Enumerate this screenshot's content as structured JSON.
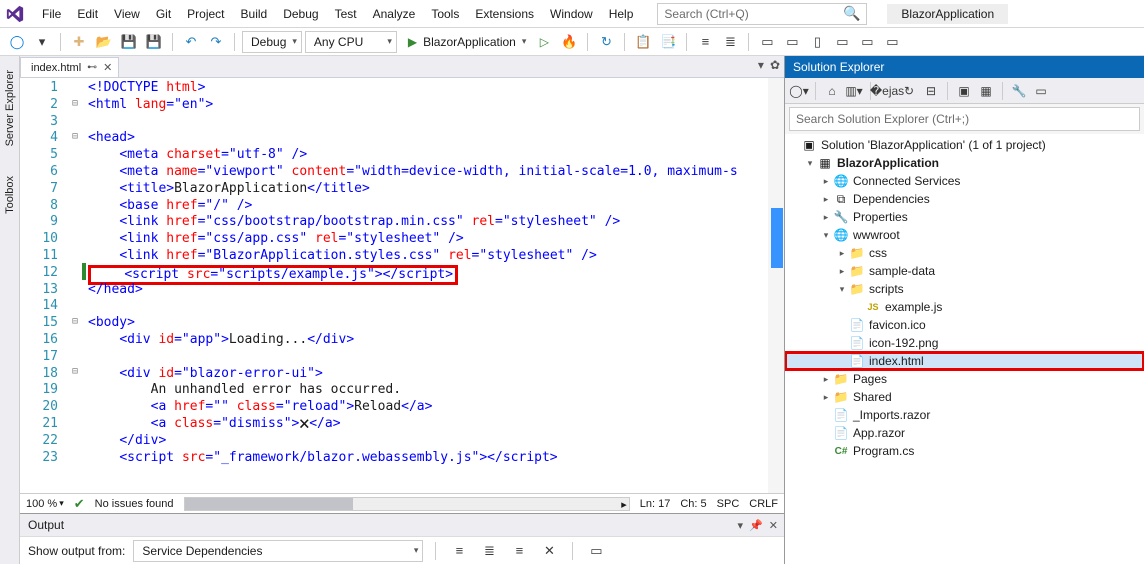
{
  "menu": {
    "items": [
      "File",
      "Edit",
      "View",
      "Git",
      "Project",
      "Build",
      "Debug",
      "Test",
      "Analyze",
      "Tools",
      "Extensions",
      "Window",
      "Help"
    ]
  },
  "header": {
    "searchPlaceholder": "Search (Ctrl+Q)",
    "appName": "BlazorApplication"
  },
  "toolbar": {
    "config": "Debug",
    "platform": "Any CPU",
    "runTarget": "BlazorApplication"
  },
  "doc": {
    "tab": "index.html"
  },
  "editor": {
    "lines": [
      {
        "n": 1,
        "fold": "",
        "chg": "",
        "html": "<span class='c-blue'>&lt;!DOCTYPE</span> <span class='c-red'>html</span><span class='c-blue'>&gt;</span>"
      },
      {
        "n": 2,
        "fold": "⊟",
        "chg": "",
        "html": "<span class='c-blue'>&lt;html</span> <span class='c-red'>lang</span><span class='c-blue'>=</span><span class='c-blue'>\"en\"</span><span class='c-blue'>&gt;</span>"
      },
      {
        "n": 3,
        "fold": "",
        "chg": "",
        "html": ""
      },
      {
        "n": 4,
        "fold": "⊟",
        "chg": "",
        "html": "<span class='c-blue'>&lt;head&gt;</span>"
      },
      {
        "n": 5,
        "fold": "",
        "chg": "",
        "html": "    <span class='c-blue'>&lt;meta</span> <span class='c-red'>charset</span><span class='c-blue'>=\"utf-8\"</span> <span class='c-blue'>/&gt;</span>"
      },
      {
        "n": 6,
        "fold": "",
        "chg": "",
        "html": "    <span class='c-blue'>&lt;meta</span> <span class='c-red'>name</span><span class='c-blue'>=\"viewport\"</span> <span class='c-red'>content</span><span class='c-blue'>=\"width=device-width, initial-scale=1.0, maximum-s</span>"
      },
      {
        "n": 7,
        "fold": "",
        "chg": "",
        "html": "    <span class='c-blue'>&lt;title&gt;</span>BlazorApplication<span class='c-blue'>&lt;/title&gt;</span>"
      },
      {
        "n": 8,
        "fold": "",
        "chg": "",
        "html": "    <span class='c-blue'>&lt;base</span> <span class='c-red'>href</span><span class='c-blue'>=\"/\"</span> <span class='c-blue'>/&gt;</span>"
      },
      {
        "n": 9,
        "fold": "",
        "chg": "",
        "html": "    <span class='c-blue'>&lt;link</span> <span class='c-red'>href</span><span class='c-blue'>=\"css/bootstrap/bootstrap.min.css\"</span> <span class='c-red'>rel</span><span class='c-blue'>=\"stylesheet\"</span> <span class='c-blue'>/&gt;</span>"
      },
      {
        "n": 10,
        "fold": "",
        "chg": "",
        "html": "    <span class='c-blue'>&lt;link</span> <span class='c-red'>href</span><span class='c-blue'>=\"css/app.css\"</span> <span class='c-red'>rel</span><span class='c-blue'>=\"stylesheet\"</span> <span class='c-blue'>/&gt;</span>"
      },
      {
        "n": 11,
        "fold": "",
        "chg": "",
        "html": "    <span class='c-blue'>&lt;link</span> <span class='c-red'>href</span><span class='c-blue'>=\"BlazorApplication.styles.css\"</span> <span class='c-red'>rel</span><span class='c-blue'>=\"stylesheet\"</span> <span class='c-blue'>/&gt;</span>"
      },
      {
        "n": 12,
        "fold": "",
        "chg": "g",
        "boxed": true,
        "html": "    <span class='c-blue'>&lt;script</span> <span class='c-red'>src</span><span class='c-blue'>=\"scripts/example.js\"&gt;&lt;/script&gt;</span>"
      },
      {
        "n": 13,
        "fold": "",
        "chg": "",
        "html": "<span class='c-blue'>&lt;/head&gt;</span>"
      },
      {
        "n": 14,
        "fold": "",
        "chg": "",
        "html": ""
      },
      {
        "n": 15,
        "fold": "⊟",
        "chg": "",
        "html": "<span class='c-blue'>&lt;body&gt;</span>"
      },
      {
        "n": 16,
        "fold": "",
        "chg": "",
        "html": "    <span class='c-blue'>&lt;div</span> <span class='c-red'>id</span><span class='c-blue'>=\"app\"&gt;</span>Loading...<span class='c-blue'>&lt;/div&gt;</span>"
      },
      {
        "n": 17,
        "fold": "",
        "chg": "",
        "html": ""
      },
      {
        "n": 18,
        "fold": "⊟",
        "chg": "",
        "html": "    <span class='c-blue'>&lt;div</span> <span class='c-red'>id</span><span class='c-blue'>=\"blazor-error-ui\"&gt;</span>"
      },
      {
        "n": 19,
        "fold": "",
        "chg": "",
        "html": "        An unhandled error has occurred."
      },
      {
        "n": 20,
        "fold": "",
        "chg": "",
        "html": "        <span class='c-blue'>&lt;a</span> <span class='c-red'>href</span><span class='c-blue'>=\"\"</span> <span class='c-red'>class</span><span class='c-blue'>=\"reload\"&gt;</span>Reload<span class='c-blue'>&lt;/a&gt;</span>"
      },
      {
        "n": 21,
        "fold": "",
        "chg": "",
        "html": "        <span class='c-blue'>&lt;a</span> <span class='c-red'>class</span><span class='c-blue'>=\"dismiss\"&gt;</span>🗙<span class='c-blue'>&lt;/a&gt;</span>"
      },
      {
        "n": 22,
        "fold": "",
        "chg": "",
        "html": "    <span class='c-blue'>&lt;/div&gt;</span>"
      },
      {
        "n": 23,
        "fold": "",
        "chg": "",
        "html": "    <span class='c-blue'>&lt;script</span> <span class='c-red'>src</span><span class='c-blue'>=\"_framework/blazor.webassembly.js\"&gt;&lt;/script&gt;</span>"
      }
    ]
  },
  "edstatus": {
    "zoom": "100 %",
    "issues": "No issues found",
    "ln": "Ln: 17",
    "ch": "Ch: 5",
    "spc": "SPC",
    "crlf": "CRLF"
  },
  "output": {
    "title": "Output",
    "label": "Show output from:",
    "source": "Service Dependencies"
  },
  "solexp": {
    "title": "Solution Explorer",
    "searchPlaceholder": "Search Solution Explorer (Ctrl+;)",
    "nodes": [
      {
        "d": 0,
        "tw": "",
        "ico": "sln",
        "label": "Solution 'BlazorApplication' (1 of 1 project)"
      },
      {
        "d": 1,
        "tw": "▾",
        "ico": "proj",
        "label": "BlazorApplication",
        "bold": true
      },
      {
        "d": 2,
        "tw": "▸",
        "ico": "globe",
        "label": "Connected Services"
      },
      {
        "d": 2,
        "tw": "▸",
        "ico": "ref",
        "label": "Dependencies"
      },
      {
        "d": 2,
        "tw": "▸",
        "ico": "wrench",
        "label": "Properties"
      },
      {
        "d": 2,
        "tw": "▾",
        "ico": "globe",
        "label": "wwwroot"
      },
      {
        "d": 3,
        "tw": "▸",
        "ico": "folder",
        "label": "css"
      },
      {
        "d": 3,
        "tw": "▸",
        "ico": "folder",
        "label": "sample-data"
      },
      {
        "d": 3,
        "tw": "▾",
        "ico": "folder",
        "label": "scripts"
      },
      {
        "d": 4,
        "tw": "",
        "ico": "js",
        "label": "example.js"
      },
      {
        "d": 3,
        "tw": "",
        "ico": "file",
        "label": "favicon.ico"
      },
      {
        "d": 3,
        "tw": "",
        "ico": "file",
        "label": "icon-192.png"
      },
      {
        "d": 3,
        "tw": "",
        "ico": "file",
        "label": "index.html",
        "sel": true,
        "red": true
      },
      {
        "d": 2,
        "tw": "▸",
        "ico": "folder",
        "label": "Pages"
      },
      {
        "d": 2,
        "tw": "▸",
        "ico": "folder",
        "label": "Shared"
      },
      {
        "d": 2,
        "tw": "",
        "ico": "file",
        "label": "_Imports.razor"
      },
      {
        "d": 2,
        "tw": "",
        "ico": "file",
        "label": "App.razor"
      },
      {
        "d": 2,
        "tw": "",
        "ico": "cs",
        "label": "Program.cs"
      }
    ]
  }
}
